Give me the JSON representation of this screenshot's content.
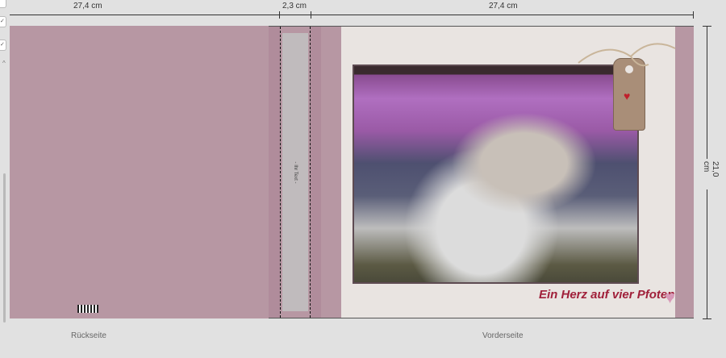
{
  "dimensions": {
    "back_width": "27,4 cm",
    "spine_width": "2,3 cm",
    "front_width": "27,4 cm",
    "height": "21,0 cm"
  },
  "spine": {
    "text": "- Ihr Text -"
  },
  "front": {
    "title": "Ein Herz auf vier Pfoten"
  },
  "labels": {
    "back": "Rückseite",
    "front": "Vorderseite"
  },
  "sidebar": {
    "checks": [
      "✓",
      "✓"
    ],
    "collapse": "^"
  },
  "colors": {
    "cover": "#b797a3",
    "title": "#a0203a"
  }
}
